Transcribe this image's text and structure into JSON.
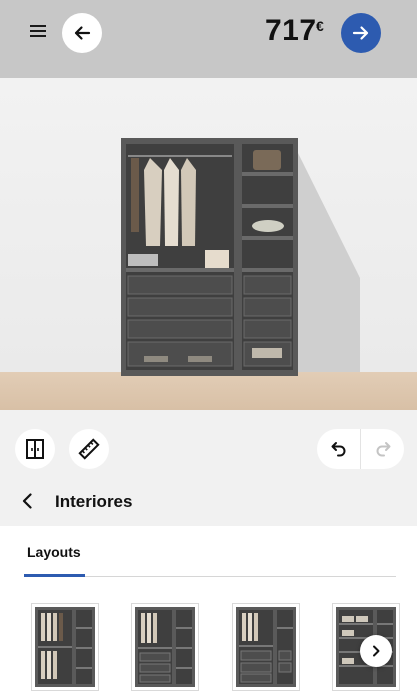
{
  "header": {
    "price_amount": "717",
    "price_currency": "€",
    "menu_icon": "hamburger-menu-icon",
    "back_icon": "arrow-left-icon",
    "next_icon": "arrow-right-icon"
  },
  "toolbar": {
    "layout_icon": "wardrobe-frame-icon",
    "measure_icon": "ruler-icon",
    "undo_icon": "undo-icon",
    "redo_icon": "redo-icon",
    "redo_enabled": false
  },
  "section": {
    "title": "Interiores",
    "back_icon": "chevron-left-icon"
  },
  "tabs": [
    {
      "label": "Layouts",
      "active": true
    }
  ],
  "layouts": [
    {
      "id": 1
    },
    {
      "id": 2
    },
    {
      "id": 3
    },
    {
      "id": 4
    }
  ],
  "colors": {
    "accent": "#2d5bb0",
    "topbar": "#c7c7c7",
    "panel": "#f1f1f1",
    "wardrobe": "#5b5b5b",
    "floor": "#dcc4aa"
  }
}
